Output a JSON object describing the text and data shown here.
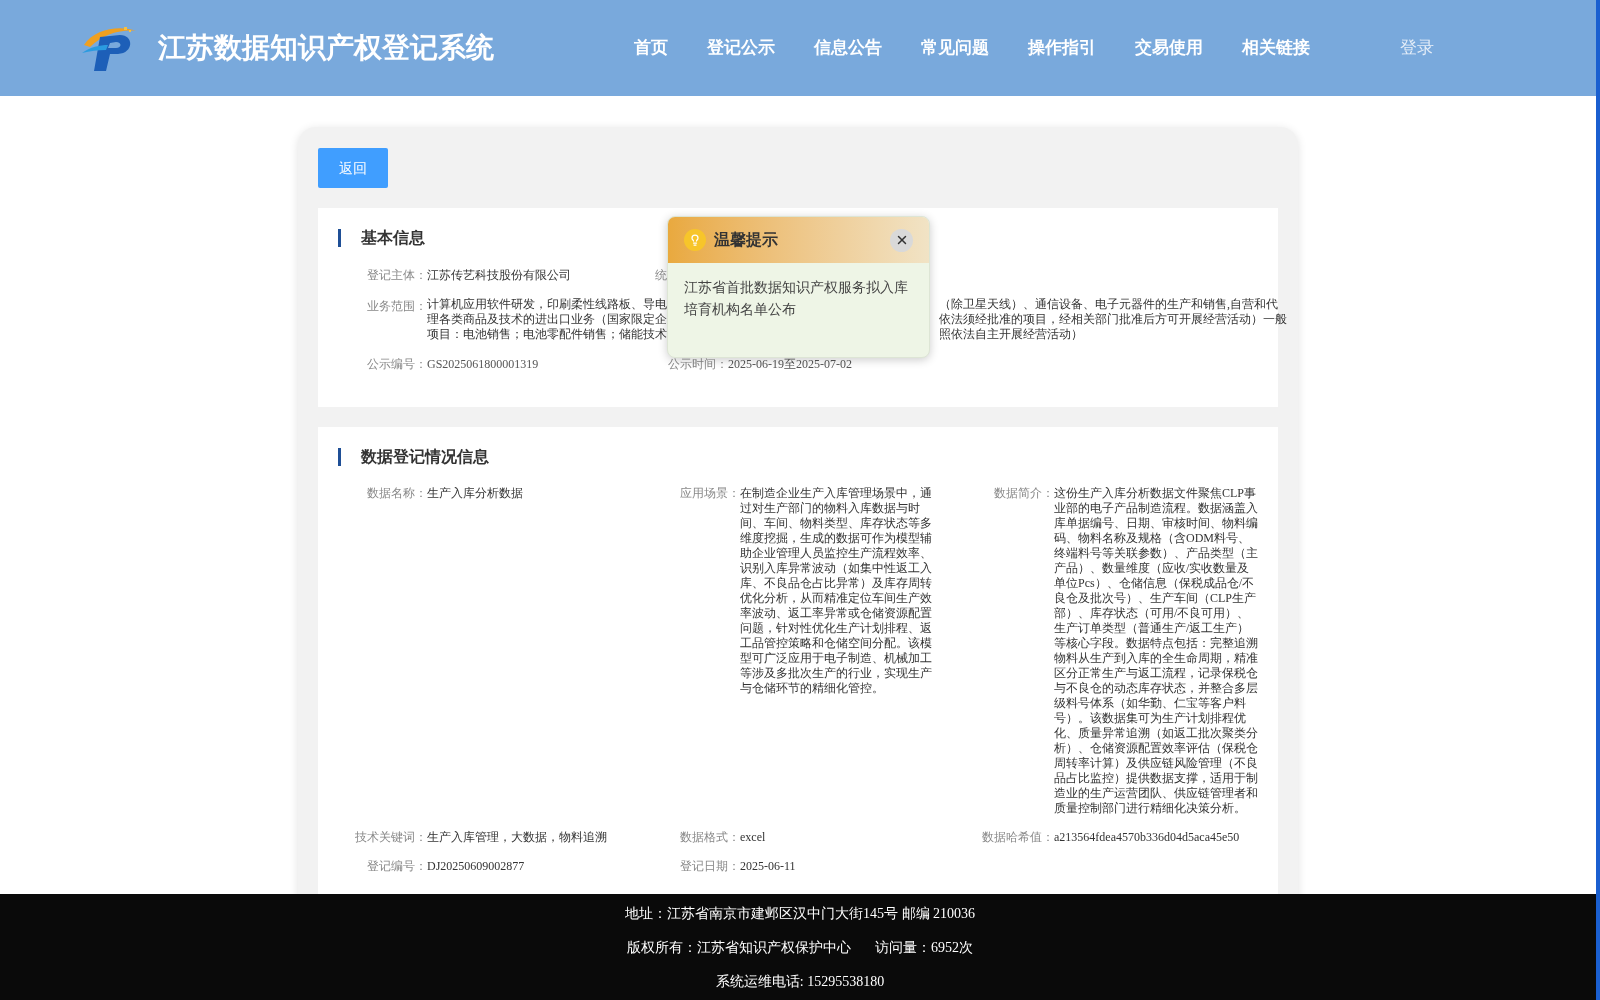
{
  "header": {
    "title": "江苏数据知识产权登记系统",
    "nav": [
      {
        "label": "首页"
      },
      {
        "label": "登记公示"
      },
      {
        "label": "信息公告"
      },
      {
        "label": "常见问题"
      },
      {
        "label": "操作指引"
      },
      {
        "label": "交易使用"
      },
      {
        "label": "相关链接"
      }
    ],
    "login": "登录"
  },
  "back_button": "返回",
  "basic_info": {
    "title": "基本信息",
    "subject": {
      "label": "登记主体：",
      "value": "江苏传艺科技股份有限公司"
    },
    "partial_label": "统",
    "scope": {
      "label": "业务范围：",
      "lines": [
        {
          "left": "计算机应用软件研发，印刷柔性线路板、导电",
          "right": "（除卫星天线）、通信设备、电子元器件的生产和销售,自营和代"
        },
        {
          "left": "理各类商品及技术的进出口业务（国家限定企",
          "right": "依法须经批准的项目，经相关部门批准后方可开展经营活动）一般"
        },
        {
          "left": "项目：电池销售；电池零配件销售；储能技术",
          "right": "照依法自主开展经营活动）"
        }
      ]
    },
    "number": {
      "label": "公示编号：",
      "value": "GS2025061800001319"
    },
    "period": {
      "label": "公示时间：",
      "value": "2025-06-19至2025-07-02"
    }
  },
  "data_info": {
    "title": "数据登记情况信息",
    "fields": [
      {
        "label": "数据名称：",
        "value": "生产入库分析数据"
      },
      {
        "label": "应用场景：",
        "value": "在制造企业生产入库管理场景中，通过对生产部门的物料入库数据与时间、车间、物料类型、库存状态等多维度挖掘，生成的数据可作为模型辅助企业管理人员监控生产流程效率、识别入库异常波动（如集中性返工入库、不良品仓占比异常）及库存周转优化分析，从而精准定位车间生产效率波动、返工率异常或仓储资源配置问题，针对性优化生产计划排程、返工品管控策略和仓储空间分配。该模型可广泛应用于电子制造、机械加工等涉及多批次生产的行业，实现生产与仓储环节的精细化管控。"
      },
      {
        "label": "数据简介：",
        "value": "这份生产入库分析数据文件聚焦CLP事业部的电子产品制造流程。数据涵盖入库单据编号、日期、审核时间、物料编码、物料名称及规格（含ODM料号、终端料号等关联参数）、产品类型（主产品）、数量维度（应收/实收数量及单位Pcs）、仓储信息（保税成品仓/不良仓及批次号）、生产车间（CLP生产部）、库存状态（可用/不良可用）、生产订单类型（普通生产/返工生产）等核心字段。数据特点包括：完整追溯物料从生产到入库的全生命周期，精准区分正常生产与返工流程，记录保税仓与不良仓的动态库存状态，并整合多层级料号体系（如华勤、仁宝等客户料号）。该数据集可为生产计划排程优化、质量异常追溯（如返工批次聚类分析）、仓储资源配置效率评估（保税仓周转率计算）及供应链风险管理（不良品占比监控）提供数据支撑，适用于制造业的生产运营团队、供应链管理者和质量控制部门进行精细化决策分析。"
      },
      {
        "label": "技术关键词：",
        "value": "生产入库管理，大数据，物料追溯"
      },
      {
        "label": "数据格式：",
        "value": "excel"
      },
      {
        "label": "数据哈希值：",
        "value": "a213564fdea4570b336d04d5aca45e50"
      },
      {
        "label": "登记编号：",
        "value": "DJ20250609002877"
      },
      {
        "label": "登记日期：",
        "value": "2025-06-11"
      }
    ]
  },
  "popup": {
    "title": "温馨提示",
    "message": "江苏省首批数据知识产权服务拟入库培育机构名单公布"
  },
  "footer": {
    "lines": [
      {
        "parts": [
          "地址：江苏省南京市建邺区汉中门大街145号 邮编 210036"
        ]
      },
      {
        "parts": [
          "版权所有：江苏省知识产权保护中心",
          "访问量：6952次"
        ]
      },
      {
        "parts": [
          "系统运维电话: 15295538180"
        ]
      }
    ]
  }
}
